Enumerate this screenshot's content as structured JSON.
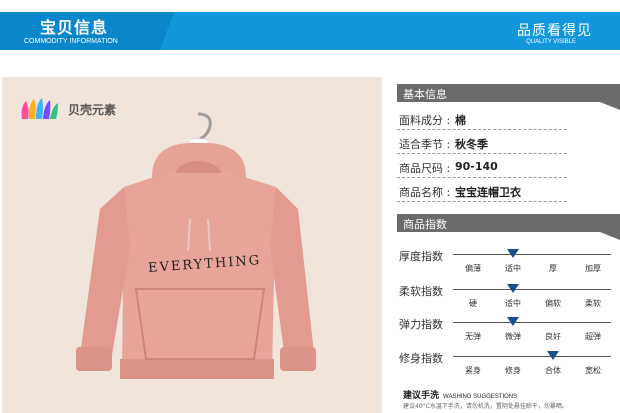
{
  "header": {
    "left_title": "宝贝信息",
    "left_subtitle": "COMMODITY INFORMATION",
    "right_title": "品质看得见",
    "right_subtitle": "QUALITY VISIBLE"
  },
  "photo": {
    "brand_label": "贝壳元素",
    "print_text": "EVERYTHING"
  },
  "basic_info": {
    "section_label": "基本信息",
    "rows": [
      {
        "key": "面料成分 :",
        "value": "棉"
      },
      {
        "key": "适合季节 :",
        "value": "秋冬季"
      },
      {
        "key": "商品尺码 :",
        "value": "90-140"
      },
      {
        "key": "商品名称 :",
        "value": "宝宝连帽卫衣"
      }
    ]
  },
  "indices": {
    "section_label": "商品指数",
    "metrics": [
      {
        "label": "厚度指数",
        "options": [
          "偏薄",
          "适中",
          "厚",
          "加厚"
        ],
        "selected_index": 1
      },
      {
        "label": "柔软指数",
        "options": [
          "硬",
          "适中",
          "偏软",
          "柔软"
        ],
        "selected_index": 1
      },
      {
        "label": "弹力指数",
        "options": [
          "无弹",
          "微弹",
          "良好",
          "超弹"
        ],
        "selected_index": 1
      },
      {
        "label": "修身指数",
        "options": [
          "紧身",
          "修身",
          "合体",
          "宽松"
        ],
        "selected_index": 2
      }
    ]
  },
  "washing": {
    "title": "建议手洗",
    "subtitle": "WASHING SUGGESTIONS",
    "text": "建议40°C水温下手洗，请勿机洗，置阴处悬挂晾干，勿暴晒。"
  },
  "colors": {
    "banner": "#1297dc",
    "banner_tab": "#0a86cc",
    "section_head": "#6b6b6b",
    "marker": "#1d4e8c",
    "hoodie": "#e8a49a",
    "photo_bg": "#f1e4da"
  }
}
